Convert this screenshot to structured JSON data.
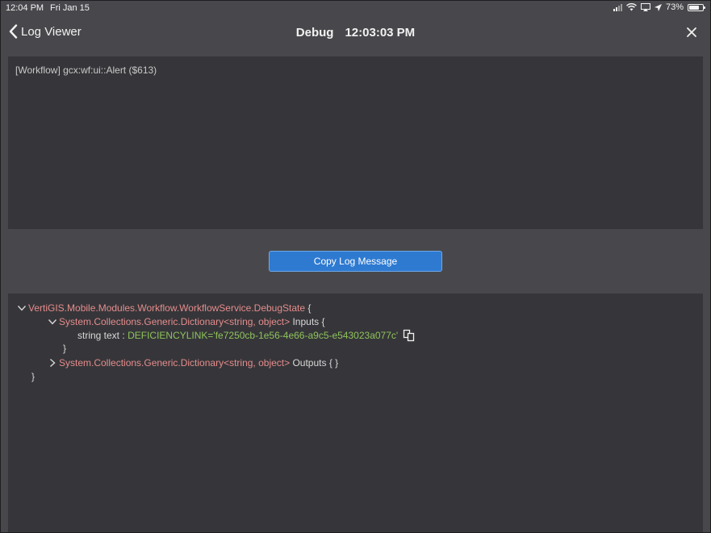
{
  "status_bar": {
    "time": "12:04 PM",
    "date": "Fri Jan 15",
    "battery": "73%",
    "battery_level": 0.73
  },
  "nav": {
    "back_label": "Log Viewer",
    "title": "Debug",
    "timestamp": "12:03:03 PM"
  },
  "message": {
    "text": "[Workflow] gcx:wf:ui::Alert ($613)"
  },
  "copy_button": {
    "label": "Copy Log Message"
  },
  "tree": {
    "root_type": "VertiGIS.Mobile.Modules.Workflow.WorkflowService.DebugState",
    "root_open": "{",
    "inputs_type": "System.Collections.Generic.Dictionary<string, object>",
    "inputs_label": "Inputs {",
    "input_item_type": "string text",
    "input_item_sep": ":",
    "input_item_value": "DEFICIENCYLINK='fe7250cb-1e56-4e66-a9c5-e543023a077c'",
    "inputs_close": "}",
    "outputs_type": "System.Collections.Generic.Dictionary<string, object>",
    "outputs_label": "Outputs { }",
    "root_close": "}"
  },
  "colors": {
    "background": "#48484c",
    "panel": "#36363a",
    "accent": "#2e7ad1",
    "type_name": "#e58c8c",
    "string_value": "#8fc35b"
  },
  "icons": [
    "signal-icon",
    "wifi-icon",
    "screen-mirror-icon",
    "location-icon",
    "battery-icon",
    "chevron-left-icon",
    "close-icon",
    "chevron-down-icon",
    "chevron-right-icon",
    "copy-icon"
  ]
}
